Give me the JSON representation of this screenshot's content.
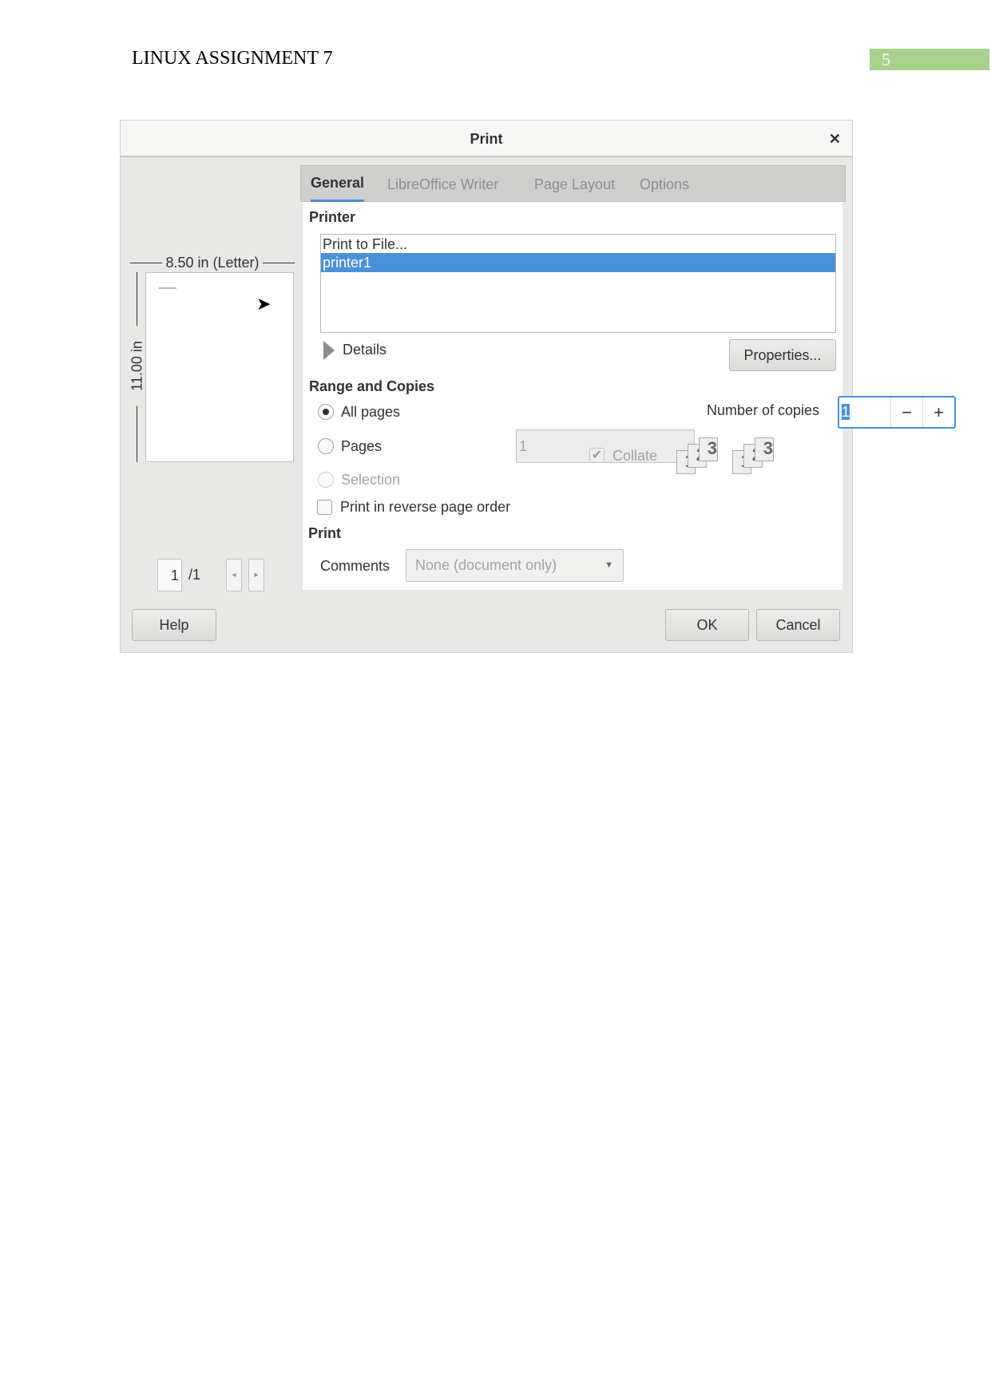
{
  "document": {
    "header": "LINUX ASSIGNMENT 7",
    "page_number": "5",
    "page_number_color": "#a9d18e"
  },
  "dialog": {
    "title": "Print",
    "close_icon": "close-icon",
    "preview": {
      "width_label": "8.50 in (Letter)",
      "height_label": "11.00 in",
      "current_page": "1",
      "total_pages": "/1"
    },
    "tabs": [
      {
        "label": "General",
        "active": true
      },
      {
        "label": "LibreOffice Writer"
      },
      {
        "label": "Page Layout"
      },
      {
        "label": "Options"
      }
    ],
    "printer": {
      "heading": "Printer",
      "items": [
        "Print to File...",
        "printer1"
      ],
      "selected": "printer1",
      "details_label": "Details",
      "properties_label": "Properties..."
    },
    "range": {
      "heading": "Range and Copies",
      "all_pages": "All pages",
      "pages": "Pages",
      "pages_value": "1",
      "selection": "Selection",
      "reverse": "Print in reverse page order",
      "selected": "All pages",
      "copies_label": "Number of copies",
      "copies_value": "1",
      "minus": "−",
      "plus": "+",
      "collate": "Collate",
      "collate_checked": true
    },
    "print": {
      "heading": "Print",
      "comments_label": "Comments",
      "comments_value": "None (document only)"
    },
    "buttons": {
      "help": "Help",
      "ok": "OK",
      "cancel": "Cancel"
    },
    "accent": "#4a90d9"
  }
}
